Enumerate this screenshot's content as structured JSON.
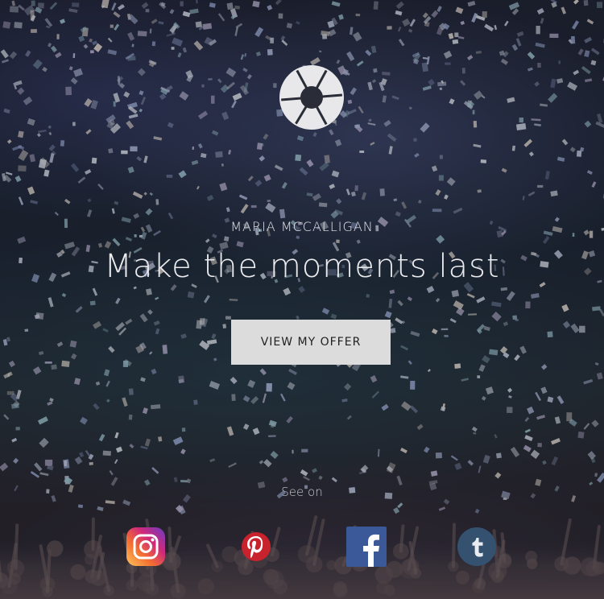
{
  "brand": {
    "name": "MARIA MCCALLIGAN",
    "logo_icon": "camera-shutter-icon"
  },
  "hero": {
    "headline": "Make the moments last",
    "cta_label": "VIEW MY OFFER"
  },
  "social": {
    "label": "See on",
    "items": [
      {
        "name": "instagram",
        "icon": "instagram-icon"
      },
      {
        "name": "pinterest",
        "icon": "pinterest-icon"
      },
      {
        "name": "facebook",
        "icon": "facebook-icon"
      },
      {
        "name": "tumblr",
        "icon": "tumblr-icon"
      }
    ]
  },
  "colors": {
    "button_bg": "#dcdcdc",
    "text_light": "#ececef",
    "pinterest": "#c8232c",
    "facebook": "#3b5998",
    "tumblr": "#34526f"
  }
}
